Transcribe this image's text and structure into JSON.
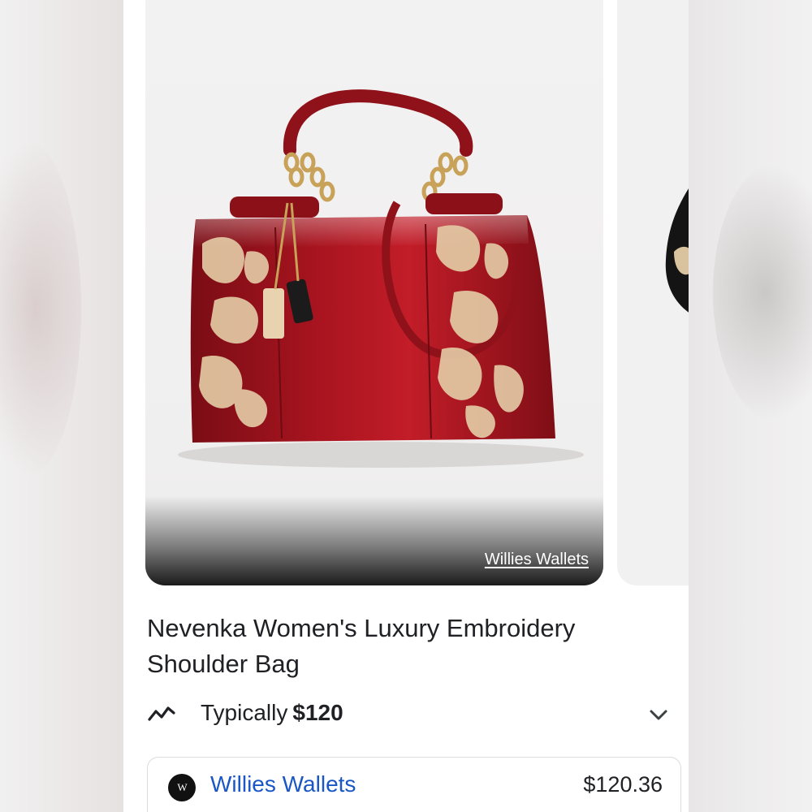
{
  "product": {
    "image_alt": "Red patent embroidered handbag",
    "image_seller_overlay": "Willies Wallets",
    "title": "Nevenka Women's Luxury Embroidery Shoulder Bag"
  },
  "price_summary": {
    "typical_label": "Typically",
    "typical_price": "$120",
    "trend_icon": "trend-line-icon",
    "expand_icon": "chevron-down-icon"
  },
  "offers": [
    {
      "seller": "Willies Wallets",
      "logo_text": "W",
      "price": "$120.36"
    }
  ],
  "colors": {
    "bag_red": "#9e1620",
    "embroidery_gold": "#e3c9a4",
    "link_blue": "#1a56c4",
    "text_dark": "#202124"
  }
}
